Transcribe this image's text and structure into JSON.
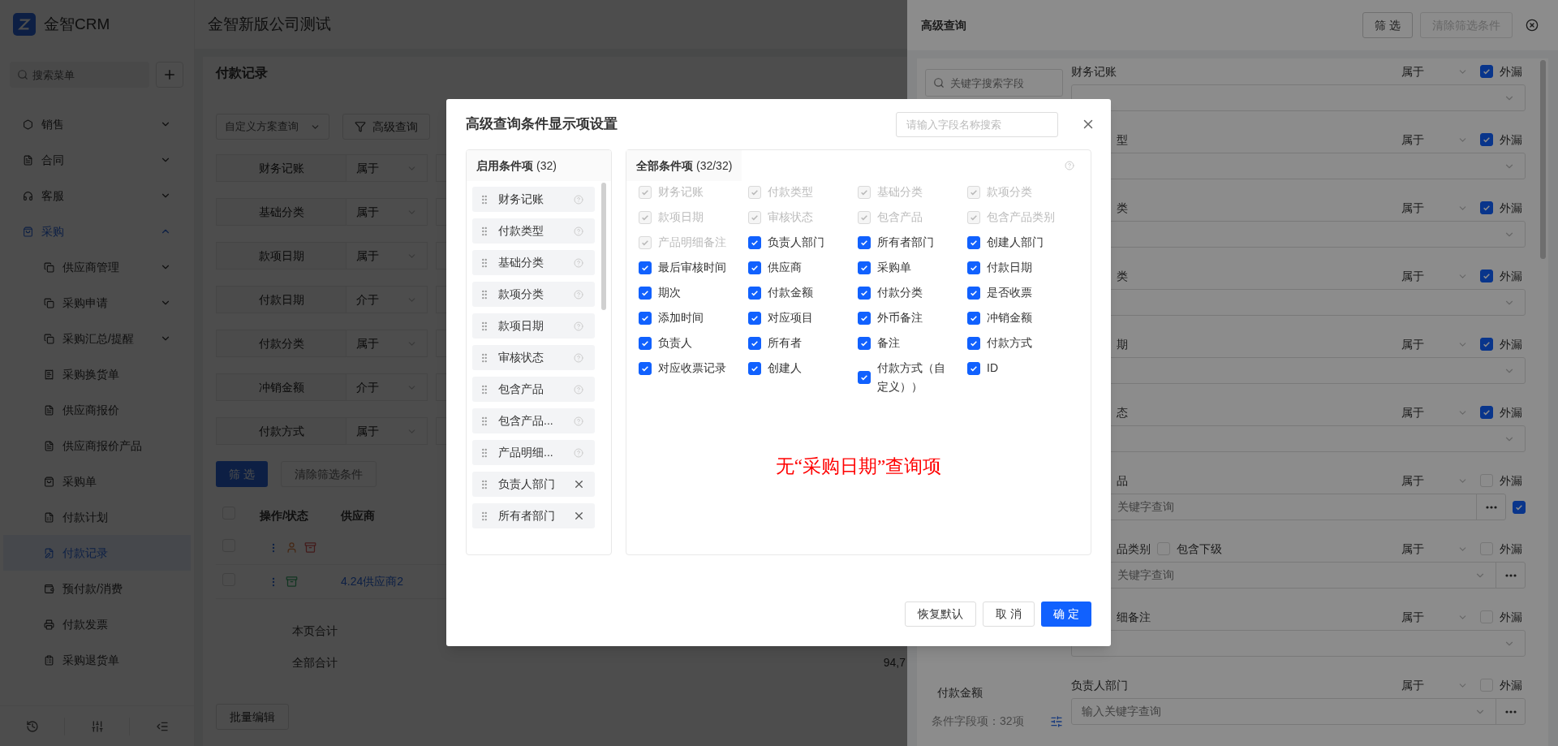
{
  "sidebar": {
    "brand": "金智CRM",
    "search": {
      "placeholder": "搜索菜单"
    },
    "items": [
      {
        "label": "销售",
        "expanded": false
      },
      {
        "label": "合同",
        "expanded": false
      },
      {
        "label": "客服",
        "expanded": false
      },
      {
        "label": "采购",
        "expanded": true,
        "children": [
          {
            "label": "供应商管理",
            "kind": "group",
            "selected": false
          },
          {
            "label": "采购申请",
            "kind": "group",
            "selected": false
          },
          {
            "label": "采购汇总/提醒",
            "kind": "group",
            "selected": false
          },
          {
            "label": "采购换货单",
            "kind": "page",
            "selected": false
          },
          {
            "label": "供应商报价",
            "kind": "page",
            "selected": false
          },
          {
            "label": "供应商报价产品",
            "kind": "page",
            "selected": false
          },
          {
            "label": "采购单",
            "kind": "page",
            "selected": false
          },
          {
            "label": "付款计划",
            "kind": "page",
            "selected": false
          },
          {
            "label": "付款记录",
            "kind": "page",
            "selected": true
          },
          {
            "label": "预付款/消费",
            "kind": "page",
            "selected": false
          },
          {
            "label": "付款发票",
            "kind": "page",
            "selected": false
          },
          {
            "label": "采购退货单",
            "kind": "page",
            "selected": false
          }
        ]
      }
    ]
  },
  "main": {
    "company": "金智新版公司测试",
    "page_title": "付款记录",
    "scheme_select": {
      "placeholder": "自定义方案查询"
    },
    "advanced_button": "高级查询",
    "filters": [
      {
        "field": "财务记账",
        "operator": "属于"
      },
      {
        "field": "基础分类",
        "operator": "属于"
      },
      {
        "field": "款项日期",
        "operator": "属于"
      },
      {
        "field": "付款日期",
        "operator": "介于"
      },
      {
        "field": "付款分类",
        "operator": "属于"
      },
      {
        "field": "冲销金额",
        "operator": "介于"
      },
      {
        "field": "付款方式",
        "operator": "属于"
      }
    ],
    "filter_button": "筛 选",
    "clear_button": "清除筛选条件",
    "table": {
      "columns": [
        "操作/状态",
        "供应商"
      ],
      "rows": [
        {
          "selected": false,
          "statuses": [
            {
              "kind": "person"
            },
            {
              "kind": "box_warn"
            }
          ]
        },
        {
          "selected": false,
          "supplier": "4.24供应商2",
          "statuses": [
            {
              "kind": "box_ok"
            }
          ]
        }
      ],
      "all_selected": false
    },
    "totals": [
      {
        "label": "本页合计"
      },
      {
        "label": "全部合计",
        "value": "94,7"
      }
    ],
    "bulk_edit_button": "批量编辑"
  },
  "drawer": {
    "title": "高级查询",
    "filter_button": "筛 选",
    "clear_button": "清除筛选条件",
    "field_search": {
      "placeholder": "关键字搜索字段"
    },
    "side_items": [
      "付款金额"
    ],
    "field_count": "条件字段项：32项",
    "rows": [
      {
        "label": "财务记账",
        "operator": "属于",
        "omit_checked": true,
        "omit_label": "外漏",
        "input": {
          "kind": "select"
        }
      },
      {
        "label": "型",
        "clipped": true,
        "operator": "属于",
        "omit_checked": true,
        "omit_label": "外漏",
        "input": {
          "kind": "select"
        }
      },
      {
        "label": "类",
        "clipped": true,
        "operator": "属于",
        "omit_checked": true,
        "omit_label": "外漏",
        "input": {
          "kind": "select"
        }
      },
      {
        "label": "类",
        "clipped": true,
        "operator": "属于",
        "omit_checked": true,
        "omit_label": "外漏",
        "input": {
          "kind": "select"
        }
      },
      {
        "label": "期",
        "clipped": true,
        "operator": "属于",
        "omit_checked": true,
        "omit_label": "外漏",
        "input": {
          "kind": "select"
        }
      },
      {
        "label": "态",
        "clipped": true,
        "operator": "属于",
        "omit_checked": true,
        "omit_label": "外漏",
        "input": {
          "kind": "select"
        }
      },
      {
        "label": "品",
        "clipped": true,
        "operator": "属于",
        "omit_checked": false,
        "omit_label": "外漏",
        "input": {
          "kind": "keyword",
          "placeholder": "关键字查询",
          "trailing_checked": true
        }
      },
      {
        "label": "品类别",
        "clipped": true,
        "operator": "属于",
        "omit_checked": false,
        "omit_label": "外漏",
        "sub_option": {
          "label": "包含下级",
          "checked": false
        },
        "input": {
          "kind": "keyword_select",
          "placeholder": "关键字查询"
        }
      },
      {
        "label": "细备注",
        "clipped": true,
        "operator": "属于",
        "omit_checked": false,
        "omit_label": "外漏",
        "input": {
          "kind": "select"
        }
      },
      {
        "label": "负责人部门",
        "operator": "属于",
        "omit_checked": false,
        "omit_label": "外漏",
        "input": {
          "kind": "keyword_select",
          "placeholder": "输入关键字查询"
        }
      }
    ]
  },
  "modal": {
    "title": "高级查询条件显示项设置",
    "search": {
      "placeholder": "请输入字段名称搜索"
    },
    "enabled": {
      "title": "启用条件项",
      "count": "(32)",
      "items": [
        {
          "label": "财务记账",
          "kind": "locked"
        },
        {
          "label": "付款类型",
          "kind": "locked"
        },
        {
          "label": "基础分类",
          "kind": "locked"
        },
        {
          "label": "款项分类",
          "kind": "locked"
        },
        {
          "label": "款项日期",
          "kind": "locked"
        },
        {
          "label": "审核状态",
          "kind": "locked"
        },
        {
          "label": "包含产品",
          "kind": "locked"
        },
        {
          "label": "包含产品...",
          "kind": "locked"
        },
        {
          "label": "产品明细...",
          "kind": "locked"
        },
        {
          "label": "负责人部门",
          "kind": "removable"
        },
        {
          "label": "所有者部门",
          "kind": "removable"
        }
      ]
    },
    "all": {
      "title": "全部条件项",
      "count": "(32/32)",
      "items": [
        {
          "label": "财务记账",
          "checked": true,
          "disabled": true
        },
        {
          "label": "付款类型",
          "checked": true,
          "disabled": true
        },
        {
          "label": "基础分类",
          "checked": true,
          "disabled": true
        },
        {
          "label": "款项分类",
          "checked": true,
          "disabled": true
        },
        {
          "label": "款项日期",
          "checked": true,
          "disabled": true
        },
        {
          "label": "审核状态",
          "checked": true,
          "disabled": true
        },
        {
          "label": "包含产品",
          "checked": true,
          "disabled": true
        },
        {
          "label": "包含产品类别",
          "checked": true,
          "disabled": true
        },
        {
          "label": "产品明细备注",
          "checked": true,
          "disabled": true
        },
        {
          "label": "负责人部门",
          "checked": true,
          "disabled": false
        },
        {
          "label": "所有者部门",
          "checked": true,
          "disabled": false
        },
        {
          "label": "创建人部门",
          "checked": true,
          "disabled": false
        },
        {
          "label": "最后审核时间",
          "checked": true,
          "disabled": false
        },
        {
          "label": "供应商",
          "checked": true,
          "disabled": false
        },
        {
          "label": "采购单",
          "checked": true,
          "disabled": false
        },
        {
          "label": "付款日期",
          "checked": true,
          "disabled": false
        },
        {
          "label": "期次",
          "checked": true,
          "disabled": false
        },
        {
          "label": "付款金额",
          "checked": true,
          "disabled": false
        },
        {
          "label": "付款分类",
          "checked": true,
          "disabled": false
        },
        {
          "label": "是否收票",
          "checked": true,
          "disabled": false
        },
        {
          "label": "添加时间",
          "checked": true,
          "disabled": false
        },
        {
          "label": "对应项目",
          "checked": true,
          "disabled": false
        },
        {
          "label": "外币备注",
          "checked": true,
          "disabled": false
        },
        {
          "label": "冲销金额",
          "checked": true,
          "disabled": false
        },
        {
          "label": "负责人",
          "checked": true,
          "disabled": false
        },
        {
          "label": "所有者",
          "checked": true,
          "disabled": false
        },
        {
          "label": "备注",
          "checked": true,
          "disabled": false
        },
        {
          "label": "付款方式",
          "checked": true,
          "disabled": false
        },
        {
          "label": "对应收票记录",
          "checked": true,
          "disabled": false
        },
        {
          "label": "创建人",
          "checked": true,
          "disabled": false
        },
        {
          "label": "付款方式（自定义））",
          "checked": true,
          "disabled": false
        },
        {
          "label": "ID",
          "checked": true,
          "disabled": false
        }
      ]
    },
    "annotation": "无“采购日期”查询项",
    "buttons": [
      {
        "label": "恢复默认",
        "kind": "default"
      },
      {
        "label": "取 消",
        "kind": "default"
      },
      {
        "label": "确 定",
        "kind": "primary"
      }
    ]
  }
}
